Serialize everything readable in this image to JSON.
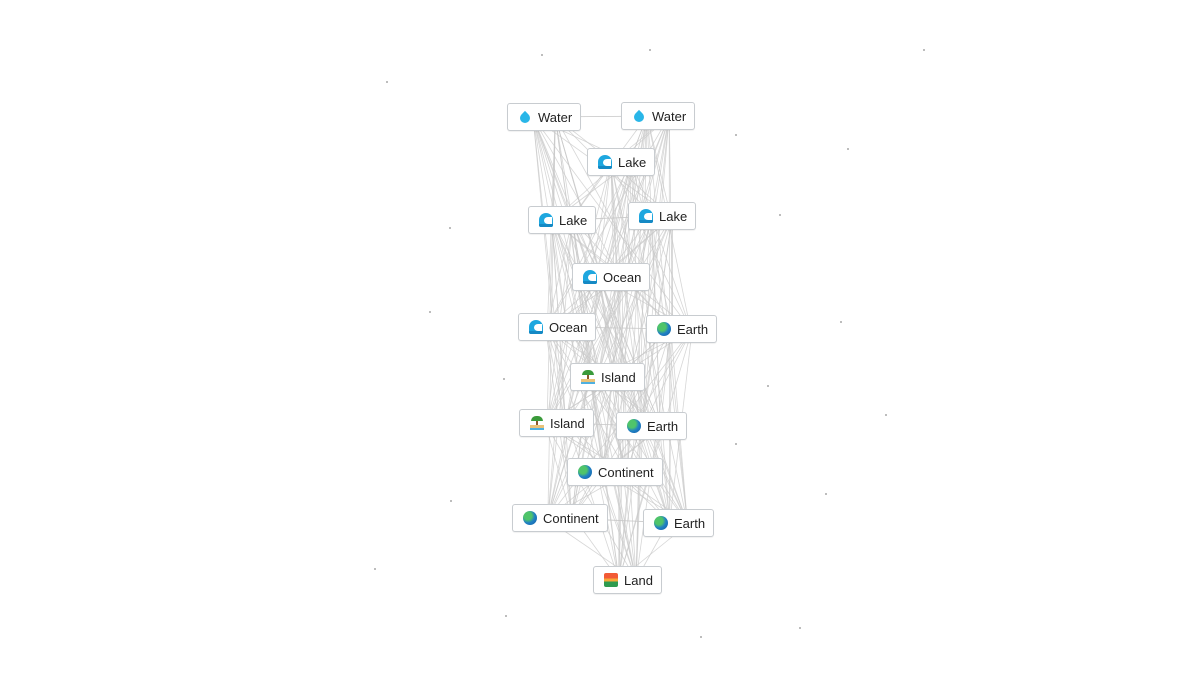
{
  "canvas": {
    "background": "#ffffff",
    "edge_color": "#c9c9c9",
    "node_border_color": "#c8ccd0"
  },
  "nodes": [
    {
      "id": "water-1",
      "label": "Water",
      "icon": "water-drop-icon"
    },
    {
      "id": "water-2",
      "label": "Water",
      "icon": "water-drop-icon"
    },
    {
      "id": "lake-1",
      "label": "Lake",
      "icon": "wave-icon"
    },
    {
      "id": "lake-2",
      "label": "Lake",
      "icon": "wave-icon"
    },
    {
      "id": "lake-3",
      "label": "Lake",
      "icon": "wave-icon"
    },
    {
      "id": "ocean-1",
      "label": "Ocean",
      "icon": "wave-icon"
    },
    {
      "id": "ocean-2",
      "label": "Ocean",
      "icon": "wave-icon"
    },
    {
      "id": "earth-1",
      "label": "Earth",
      "icon": "globe-icon"
    },
    {
      "id": "island-1",
      "label": "Island",
      "icon": "palm-island-icon"
    },
    {
      "id": "island-2",
      "label": "Island",
      "icon": "palm-island-icon"
    },
    {
      "id": "earth-2",
      "label": "Earth",
      "icon": "globe-icon"
    },
    {
      "id": "continent-1",
      "label": "Continent",
      "icon": "globe-icon"
    },
    {
      "id": "continent-2",
      "label": "Continent",
      "icon": "globe-icon"
    },
    {
      "id": "earth-3",
      "label": "Earth",
      "icon": "globe-icon"
    },
    {
      "id": "land-1",
      "label": "Land",
      "icon": "landscape-icon"
    }
  ],
  "edges": "all-pairs"
}
